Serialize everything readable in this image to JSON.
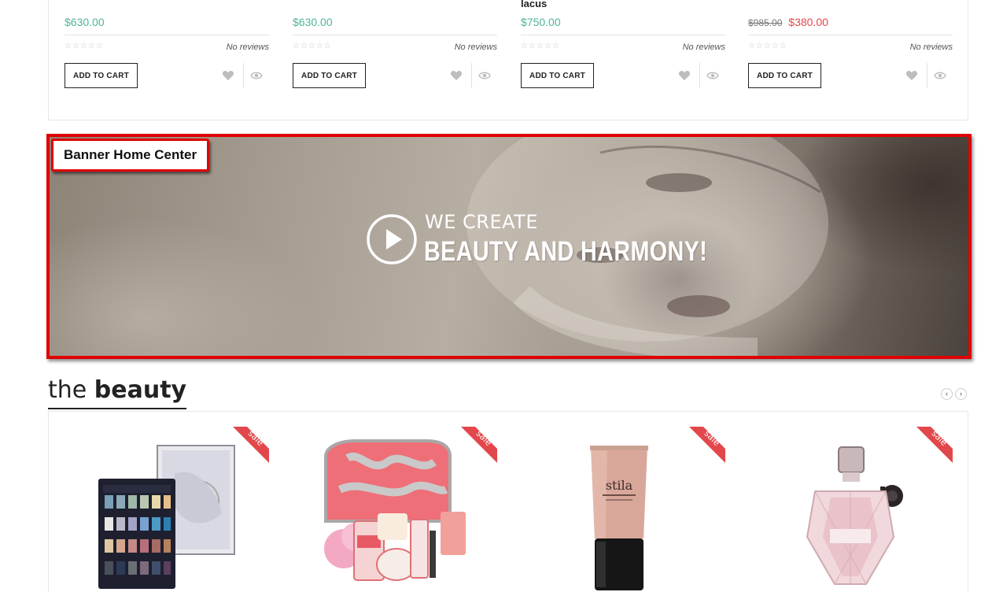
{
  "top_products": [
    {
      "name": "",
      "price": "$630.00",
      "old_price": "",
      "new_price": "",
      "stars": "☆☆☆☆☆",
      "reviews": "No reviews",
      "cart_label": "ADD TO CART"
    },
    {
      "name": "",
      "price": "$630.00",
      "old_price": "",
      "new_price": "",
      "stars": "☆☆☆☆☆",
      "reviews": "No reviews",
      "cart_label": "ADD TO CART"
    },
    {
      "name": "lacus",
      "price": "$750.00",
      "old_price": "",
      "new_price": "",
      "stars": "☆☆☆☆☆",
      "reviews": "No reviews",
      "cart_label": "ADD TO CART"
    },
    {
      "name": "",
      "price": "",
      "old_price": "$985.00",
      "new_price": "$380.00",
      "stars": "☆☆☆☆☆",
      "reviews": "No reviews",
      "cart_label": "ADD TO CART"
    }
  ],
  "banner": {
    "tag": "Banner Home Center",
    "line1": "WE CREATE",
    "line2": "BEAUTY AND HARMONY!"
  },
  "section": {
    "title_light": "the",
    "title_bold": "beauty",
    "prev_arrow": "‹",
    "next_arrow": "›"
  },
  "beauty_products": [
    {
      "badge": "sale",
      "image": "eyeshadow-palette"
    },
    {
      "badge": "sale",
      "image": "toiletry-bag-set"
    },
    {
      "badge": "sale",
      "image": "stila-tube"
    },
    {
      "badge": "sale",
      "image": "perfume-bottle"
    }
  ],
  "colors": {
    "price_green": "#4db39b",
    "sale_red": "#e2474b",
    "highlight_red": "#e00000"
  }
}
